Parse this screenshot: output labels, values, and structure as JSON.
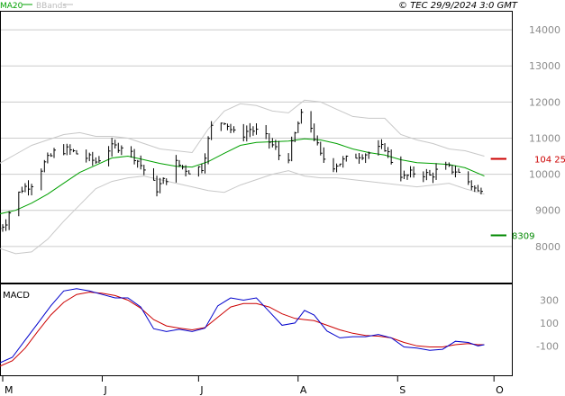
{
  "header": {
    "legend_ma20": "MA20",
    "legend_bbands": "BBands",
    "timestamp": "© TEC 29/9/2024 3:0 GMT"
  },
  "colors": {
    "price": "#000000",
    "ma20": "#00a000",
    "bbands": "#c8c8c8",
    "grid": "#cccccc",
    "resistance": "#cc0000",
    "support": "#008800",
    "macd": "#0000cc",
    "signal": "#cc0000",
    "legend_ma20": "#00a000",
    "legend_bbands": "#bbbbbb"
  },
  "chart_data": [
    {
      "type": "line",
      "panel": "price",
      "yticks": [
        8000,
        9000,
        10000,
        11000,
        12000,
        13000,
        14000
      ],
      "ytick_labels": [
        "8000",
        "9000",
        "10000",
        "11000",
        "12000",
        "13000",
        "14000"
      ],
      "ylim": [
        7000,
        14500
      ],
      "x_range": [
        "2024-05-01",
        "2024-10-06"
      ],
      "month_ticks": [
        {
          "date": "2024-05-01",
          "label": "M"
        },
        {
          "date": "2024-06-01",
          "label": "J"
        },
        {
          "date": "2024-07-01",
          "label": "J"
        },
        {
          "date": "2024-08-01",
          "label": "A"
        },
        {
          "date": "2024-09-01",
          "label": "S"
        },
        {
          "date": "2024-10-01",
          "label": "O"
        }
      ],
      "resistance": {
        "value": 10425,
        "label": "104 25",
        "from": "2024-09-30"
      },
      "support": {
        "value": 8309,
        "label": "8309",
        "from": "2024-09-30"
      },
      "price_close": [
        [
          "2024-04-30",
          8500
        ],
        [
          "2024-05-02",
          8700
        ],
        [
          "2024-05-04",
          9200
        ],
        [
          "2024-05-07",
          9600
        ],
        [
          "2024-05-10",
          9750
        ],
        [
          "2024-05-14",
          10300
        ],
        [
          "2024-05-18",
          10700
        ],
        [
          "2024-05-22",
          10650
        ],
        [
          "2024-05-26",
          10500
        ],
        [
          "2024-05-30",
          10350
        ],
        [
          "2024-06-03",
          10700
        ],
        [
          "2024-06-07",
          10800
        ],
        [
          "2024-06-11",
          10500
        ],
        [
          "2024-06-15",
          10000
        ],
        [
          "2024-06-18",
          9600
        ],
        [
          "2024-06-21",
          9900
        ],
        [
          "2024-06-24",
          10300
        ],
        [
          "2024-06-28",
          10100
        ],
        [
          "2024-07-02",
          10200
        ],
        [
          "2024-07-05",
          11300
        ],
        [
          "2024-07-09",
          11500
        ],
        [
          "2024-07-13",
          11000
        ],
        [
          "2024-07-17",
          11250
        ],
        [
          "2024-07-21",
          11100
        ],
        [
          "2024-07-25",
          10700
        ],
        [
          "2024-07-28",
          10200
        ],
        [
          "2024-08-01",
          11400
        ],
        [
          "2024-08-03",
          11800
        ],
        [
          "2024-08-05",
          11300
        ],
        [
          "2024-08-08",
          10500
        ],
        [
          "2024-08-12",
          10250
        ],
        [
          "2024-08-16",
          10400
        ],
        [
          "2024-08-20",
          10550
        ],
        [
          "2024-08-24",
          10600
        ],
        [
          "2024-08-28",
          10750
        ],
        [
          "2024-08-31",
          10200
        ],
        [
          "2024-09-03",
          9900
        ],
        [
          "2024-09-07",
          10100
        ],
        [
          "2024-09-11",
          9950
        ],
        [
          "2024-09-15",
          10200
        ],
        [
          "2024-09-19",
          10100
        ],
        [
          "2024-09-23",
          9800
        ],
        [
          "2024-09-26",
          9500
        ],
        [
          "2024-09-28",
          9800
        ]
      ],
      "ma20": [
        [
          "2024-04-30",
          8900
        ],
        [
          "2024-05-05",
          9000
        ],
        [
          "2024-05-10",
          9200
        ],
        [
          "2024-05-15",
          9450
        ],
        [
          "2024-05-20",
          9750
        ],
        [
          "2024-05-25",
          10050
        ],
        [
          "2024-05-30",
          10250
        ],
        [
          "2024-06-04",
          10450
        ],
        [
          "2024-06-09",
          10500
        ],
        [
          "2024-06-14",
          10400
        ],
        [
          "2024-06-19",
          10300
        ],
        [
          "2024-06-24",
          10220
        ],
        [
          "2024-06-29",
          10200
        ],
        [
          "2024-07-04",
          10350
        ],
        [
          "2024-07-09",
          10580
        ],
        [
          "2024-07-14",
          10800
        ],
        [
          "2024-07-19",
          10880
        ],
        [
          "2024-07-24",
          10900
        ],
        [
          "2024-07-29",
          10920
        ],
        [
          "2024-08-03",
          10980
        ],
        [
          "2024-08-08",
          10950
        ],
        [
          "2024-08-13",
          10850
        ],
        [
          "2024-08-18",
          10700
        ],
        [
          "2024-08-23",
          10600
        ],
        [
          "2024-08-28",
          10530
        ],
        [
          "2024-09-02",
          10400
        ],
        [
          "2024-09-07",
          10320
        ],
        [
          "2024-09-12",
          10300
        ],
        [
          "2024-09-17",
          10270
        ],
        [
          "2024-09-22",
          10180
        ],
        [
          "2024-09-28",
          9950
        ]
      ],
      "bb_upper": [
        [
          "2024-04-30",
          10300
        ],
        [
          "2024-05-05",
          10550
        ],
        [
          "2024-05-10",
          10800
        ],
        [
          "2024-05-15",
          10950
        ],
        [
          "2024-05-20",
          11100
        ],
        [
          "2024-05-25",
          11150
        ],
        [
          "2024-05-30",
          11050
        ],
        [
          "2024-06-04",
          11050
        ],
        [
          "2024-06-09",
          11000
        ],
        [
          "2024-06-14",
          10850
        ],
        [
          "2024-06-19",
          10700
        ],
        [
          "2024-06-24",
          10650
        ],
        [
          "2024-06-29",
          10600
        ],
        [
          "2024-07-04",
          11250
        ],
        [
          "2024-07-09",
          11750
        ],
        [
          "2024-07-14",
          11950
        ],
        [
          "2024-07-19",
          11900
        ],
        [
          "2024-07-24",
          11750
        ],
        [
          "2024-07-29",
          11700
        ],
        [
          "2024-08-03",
          12050
        ],
        [
          "2024-08-08",
          12000
        ],
        [
          "2024-08-13",
          11800
        ],
        [
          "2024-08-18",
          11600
        ],
        [
          "2024-08-23",
          11550
        ],
        [
          "2024-08-28",
          11550
        ],
        [
          "2024-09-02",
          11100
        ],
        [
          "2024-09-07",
          10950
        ],
        [
          "2024-09-12",
          10850
        ],
        [
          "2024-09-17",
          10700
        ],
        [
          "2024-09-22",
          10650
        ],
        [
          "2024-09-28",
          10500
        ]
      ],
      "bb_lower": [
        [
          "2024-04-30",
          7950
        ],
        [
          "2024-05-05",
          7800
        ],
        [
          "2024-05-10",
          7850
        ],
        [
          "2024-05-15",
          8200
        ],
        [
          "2024-05-20",
          8700
        ],
        [
          "2024-05-25",
          9150
        ],
        [
          "2024-05-30",
          9600
        ],
        [
          "2024-06-04",
          9800
        ],
        [
          "2024-06-09",
          9900
        ],
        [
          "2024-06-14",
          9950
        ],
        [
          "2024-06-19",
          9850
        ],
        [
          "2024-06-24",
          9750
        ],
        [
          "2024-06-29",
          9650
        ],
        [
          "2024-07-04",
          9550
        ],
        [
          "2024-07-09",
          9500
        ],
        [
          "2024-07-14",
          9700
        ],
        [
          "2024-07-19",
          9850
        ],
        [
          "2024-07-24",
          10000
        ],
        [
          "2024-07-29",
          10100
        ],
        [
          "2024-08-03",
          9950
        ],
        [
          "2024-08-08",
          9900
        ],
        [
          "2024-08-13",
          9900
        ],
        [
          "2024-08-18",
          9850
        ],
        [
          "2024-08-23",
          9800
        ],
        [
          "2024-08-28",
          9750
        ],
        [
          "2024-09-02",
          9700
        ],
        [
          "2024-09-07",
          9650
        ],
        [
          "2024-09-12",
          9700
        ],
        [
          "2024-09-17",
          9750
        ],
        [
          "2024-09-22",
          9600
        ],
        [
          "2024-09-28",
          9450
        ]
      ]
    },
    {
      "type": "line",
      "panel": "macd",
      "title": "MACD",
      "yticks": [
        300,
        100,
        -100
      ],
      "ytick_labels": [
        "300",
        "100",
        "-100"
      ],
      "ylim": [
        -350,
        430
      ],
      "macd": [
        [
          "2024-04-30",
          -250
        ],
        [
          "2024-05-04",
          -200
        ],
        [
          "2024-05-08",
          -50
        ],
        [
          "2024-05-12",
          100
        ],
        [
          "2024-05-16",
          250
        ],
        [
          "2024-05-20",
          380
        ],
        [
          "2024-05-24",
          400
        ],
        [
          "2024-05-28",
          380
        ],
        [
          "2024-06-01",
          350
        ],
        [
          "2024-06-05",
          320
        ],
        [
          "2024-06-09",
          320
        ],
        [
          "2024-06-13",
          240
        ],
        [
          "2024-06-17",
          50
        ],
        [
          "2024-06-21",
          25
        ],
        [
          "2024-06-25",
          45
        ],
        [
          "2024-06-29",
          25
        ],
        [
          "2024-07-03",
          55
        ],
        [
          "2024-07-07",
          250
        ],
        [
          "2024-07-11",
          320
        ],
        [
          "2024-07-15",
          300
        ],
        [
          "2024-07-19",
          320
        ],
        [
          "2024-07-23",
          200
        ],
        [
          "2024-07-27",
          80
        ],
        [
          "2024-07-31",
          100
        ],
        [
          "2024-08-03",
          210
        ],
        [
          "2024-08-06",
          170
        ],
        [
          "2024-08-10",
          30
        ],
        [
          "2024-08-14",
          -30
        ],
        [
          "2024-08-18",
          -20
        ],
        [
          "2024-08-22",
          -20
        ],
        [
          "2024-08-26",
          0
        ],
        [
          "2024-08-30",
          -30
        ],
        [
          "2024-09-03",
          -110
        ],
        [
          "2024-09-07",
          -120
        ],
        [
          "2024-09-11",
          -140
        ],
        [
          "2024-09-15",
          -130
        ],
        [
          "2024-09-19",
          -60
        ],
        [
          "2024-09-23",
          -70
        ],
        [
          "2024-09-26",
          -100
        ],
        [
          "2024-09-28",
          -90
        ]
      ],
      "signal": [
        [
          "2024-04-30",
          -280
        ],
        [
          "2024-05-04",
          -230
        ],
        [
          "2024-05-08",
          -120
        ],
        [
          "2024-05-12",
          30
        ],
        [
          "2024-05-16",
          170
        ],
        [
          "2024-05-20",
          280
        ],
        [
          "2024-05-24",
          350
        ],
        [
          "2024-05-28",
          370
        ],
        [
          "2024-06-01",
          360
        ],
        [
          "2024-06-05",
          340
        ],
        [
          "2024-06-09",
          300
        ],
        [
          "2024-06-13",
          230
        ],
        [
          "2024-06-17",
          130
        ],
        [
          "2024-06-21",
          75
        ],
        [
          "2024-06-25",
          55
        ],
        [
          "2024-06-29",
          40
        ],
        [
          "2024-07-03",
          60
        ],
        [
          "2024-07-07",
          150
        ],
        [
          "2024-07-11",
          240
        ],
        [
          "2024-07-15",
          270
        ],
        [
          "2024-07-19",
          270
        ],
        [
          "2024-07-23",
          240
        ],
        [
          "2024-07-27",
          180
        ],
        [
          "2024-07-31",
          140
        ],
        [
          "2024-08-03",
          130
        ],
        [
          "2024-08-06",
          120
        ],
        [
          "2024-08-10",
          80
        ],
        [
          "2024-08-14",
          40
        ],
        [
          "2024-08-18",
          10
        ],
        [
          "2024-08-22",
          -10
        ],
        [
          "2024-08-26",
          -15
        ],
        [
          "2024-08-30",
          -30
        ],
        [
          "2024-09-03",
          -70
        ],
        [
          "2024-09-07",
          -100
        ],
        [
          "2024-09-11",
          -110
        ],
        [
          "2024-09-15",
          -110
        ],
        [
          "2024-09-19",
          -90
        ],
        [
          "2024-09-23",
          -80
        ],
        [
          "2024-09-26",
          -90
        ],
        [
          "2024-09-28",
          -90
        ]
      ]
    }
  ]
}
